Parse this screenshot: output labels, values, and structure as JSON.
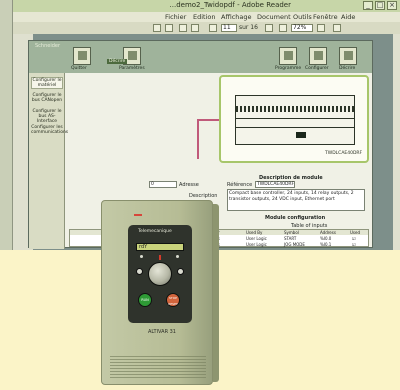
{
  "window": {
    "title": "...demo2_Twidopdf - Adobe Reader",
    "controls": [
      "_",
      "□",
      "×"
    ]
  },
  "menubar": {
    "items": [
      "Aide",
      "Fenêtre",
      "Outils",
      "Document",
      "Affichage",
      "Edition",
      "Fichier"
    ]
  },
  "toolbar": {
    "page_number": "11",
    "page_total": "sur 16",
    "zoom": "72%"
  },
  "app": {
    "logo_text": "Schneider",
    "tabs": [
      {
        "label": "Quitter"
      },
      {
        "label": "Paramètres"
      },
      {
        "label": "Programme"
      },
      {
        "label": "Configurer"
      },
      {
        "label": "Décrire"
      }
    ],
    "tag_label": "Décrire",
    "nav": [
      {
        "label": "Configurer le matériel",
        "selected": true
      },
      {
        "label": "Configurer le bus CANopen",
        "selected": false
      },
      {
        "label": "Configurer le bus AS-Interface",
        "selected": false
      },
      {
        "label": "Configurer les communications",
        "selected": false
      }
    ],
    "preview_label": "TWDLCAE40DRF"
  },
  "description": {
    "section_title": "Description de module",
    "reference_label": "Référence",
    "reference_value": "TWDLCAE40DRF",
    "address_label": "Adresse",
    "address_value": "0",
    "description_label": "Description",
    "description_text": "Compact base controller, 24 inputs, 14 relay outputs, 2 transistor outputs, 24 VDC input, Ethernet port",
    "config_title": "Module configuration",
    "table_title": "Table of inputs",
    "table_rows": [
      [
        "Used",
        "Address",
        "Symbol",
        "Used By",
        "Filter",
        "Latch?"
      ],
      [
        "☑",
        "%I0.0",
        "START",
        "User Logic",
        "3 ms",
        ""
      ],
      [
        "☑",
        "%I0.1",
        "JOG MODE",
        "User Logic",
        "3 ms",
        ""
      ]
    ]
  },
  "device": {
    "brand": "Telemecanique",
    "screen_text": "rdY",
    "run_label": "RUN",
    "stop_label": "STOP RESET",
    "model_label": "ALTIVAR 31",
    "colors": {
      "run": "#2e9a35",
      "stop": "#d2643c",
      "screen": "#c9d37b"
    }
  }
}
